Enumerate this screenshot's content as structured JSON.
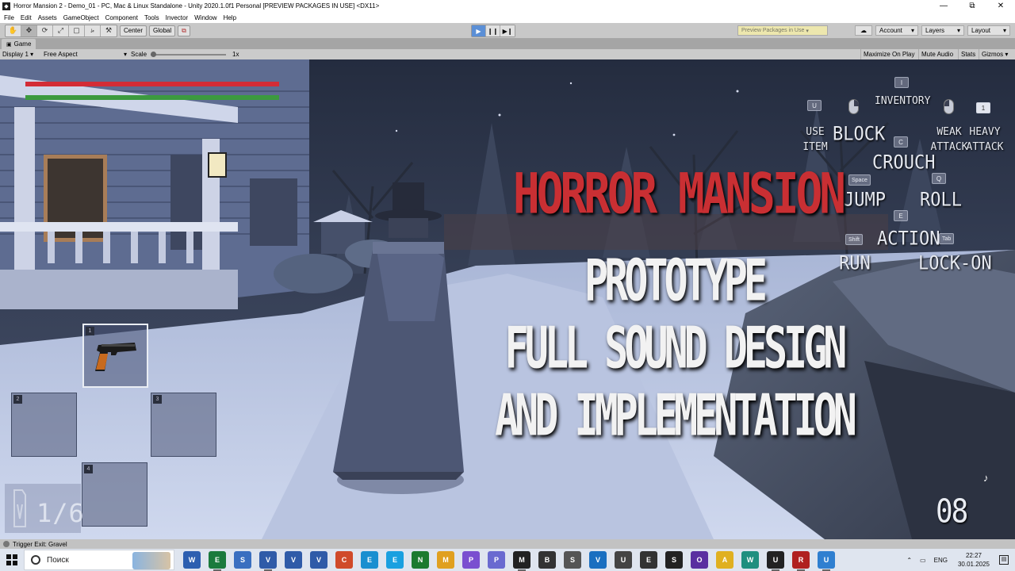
{
  "window": {
    "title": "Horror Mansion 2 - Demo_01 - PC, Mac & Linux Standalone - Unity 2020.1.0f1 Personal [PREVIEW PACKAGES IN USE] <DX11>",
    "minimize": "—",
    "maximize": "⧉",
    "close": "✕"
  },
  "menu": [
    "File",
    "Edit",
    "Assets",
    "GameObject",
    "Component",
    "Tools",
    "Invector",
    "Window",
    "Help"
  ],
  "toolbar": {
    "tools": [
      "✋",
      "✥",
      "⟳",
      "⤢",
      "▢",
      "⭟",
      "⚒"
    ],
    "center_label": "Center",
    "global_label": "Global",
    "play": "▶",
    "pause": "❙❙",
    "step": "▶❙",
    "preview_packages": "Preview Packages in Use",
    "account": "Account",
    "layers": "Layers",
    "layout": "Layout"
  },
  "game_tab": {
    "label": "Game"
  },
  "game_bar": {
    "display": "Display 1",
    "aspect": "Free Aspect",
    "scale_label": "Scale",
    "scale_value": "1x",
    "scale_fraction": 0.0,
    "maximize_on_play": "Maximize On Play",
    "mute_audio": "Mute Audio",
    "stats": "Stats",
    "gizmos": "Gizmos"
  },
  "hud": {
    "health_fraction": 1.0,
    "stamina_fraction": 1.0,
    "slots": [
      {
        "number": "1",
        "item": "pistol"
      },
      {
        "number": "2",
        "item": ""
      },
      {
        "number": "3",
        "item": ""
      },
      {
        "number": "4",
        "item": ""
      }
    ],
    "ammo": "1/6",
    "counter": "08"
  },
  "controls": [
    {
      "key": "U",
      "label_line1": "USE",
      "label_line2": "ITEM"
    },
    {
      "key": "mouse-right",
      "label_line1": "BLOCK",
      "label_line2": ""
    },
    {
      "key": "I",
      "label_line1": "INVENTORY",
      "label_line2": ""
    },
    {
      "key": "mouse-left",
      "label_line1": "WEAK",
      "label_line2": "ATTACK"
    },
    {
      "key": "1",
      "label_line1": "HEAVY",
      "label_line2": "ATTACK"
    },
    {
      "key": "C",
      "label_line1": "CROUCH",
      "label_line2": ""
    },
    {
      "key": "Space",
      "label_line1": "JUMP",
      "label_line2": ""
    },
    {
      "key": "Q",
      "label_line1": "ROLL",
      "label_line2": ""
    },
    {
      "key": "E",
      "label_line1": "ACTION",
      "label_line2": ""
    },
    {
      "key": "Shift",
      "label_line1": "RUN",
      "label_line2": ""
    },
    {
      "key": "Tab",
      "label_line1": "LOCK-ON",
      "label_line2": ""
    }
  ],
  "promo": {
    "title": "HORROR MANSION",
    "line1": "PROTOTYPE",
    "line2": "FULL SOUND DESIGN",
    "line3": "AND IMPLEMENTATION"
  },
  "status_bar": {
    "message": "Trigger Exit: Gravel"
  },
  "taskbar": {
    "search_placeholder": "Поиск",
    "apps": [
      "W",
      "E",
      "S",
      "V",
      "V",
      "V",
      "C",
      "E",
      "E",
      "N",
      "M",
      "P",
      "P",
      "M",
      "B",
      "S",
      "V",
      "U",
      "E",
      "S",
      "O",
      "A",
      "W",
      "U",
      "R",
      "U"
    ],
    "lang": "ENG",
    "time": "22:27",
    "date": "30.01.2025"
  },
  "colors": {
    "health": "#d32c36",
    "stamina": "#3c9a3f",
    "title_red": "#c92f33"
  }
}
